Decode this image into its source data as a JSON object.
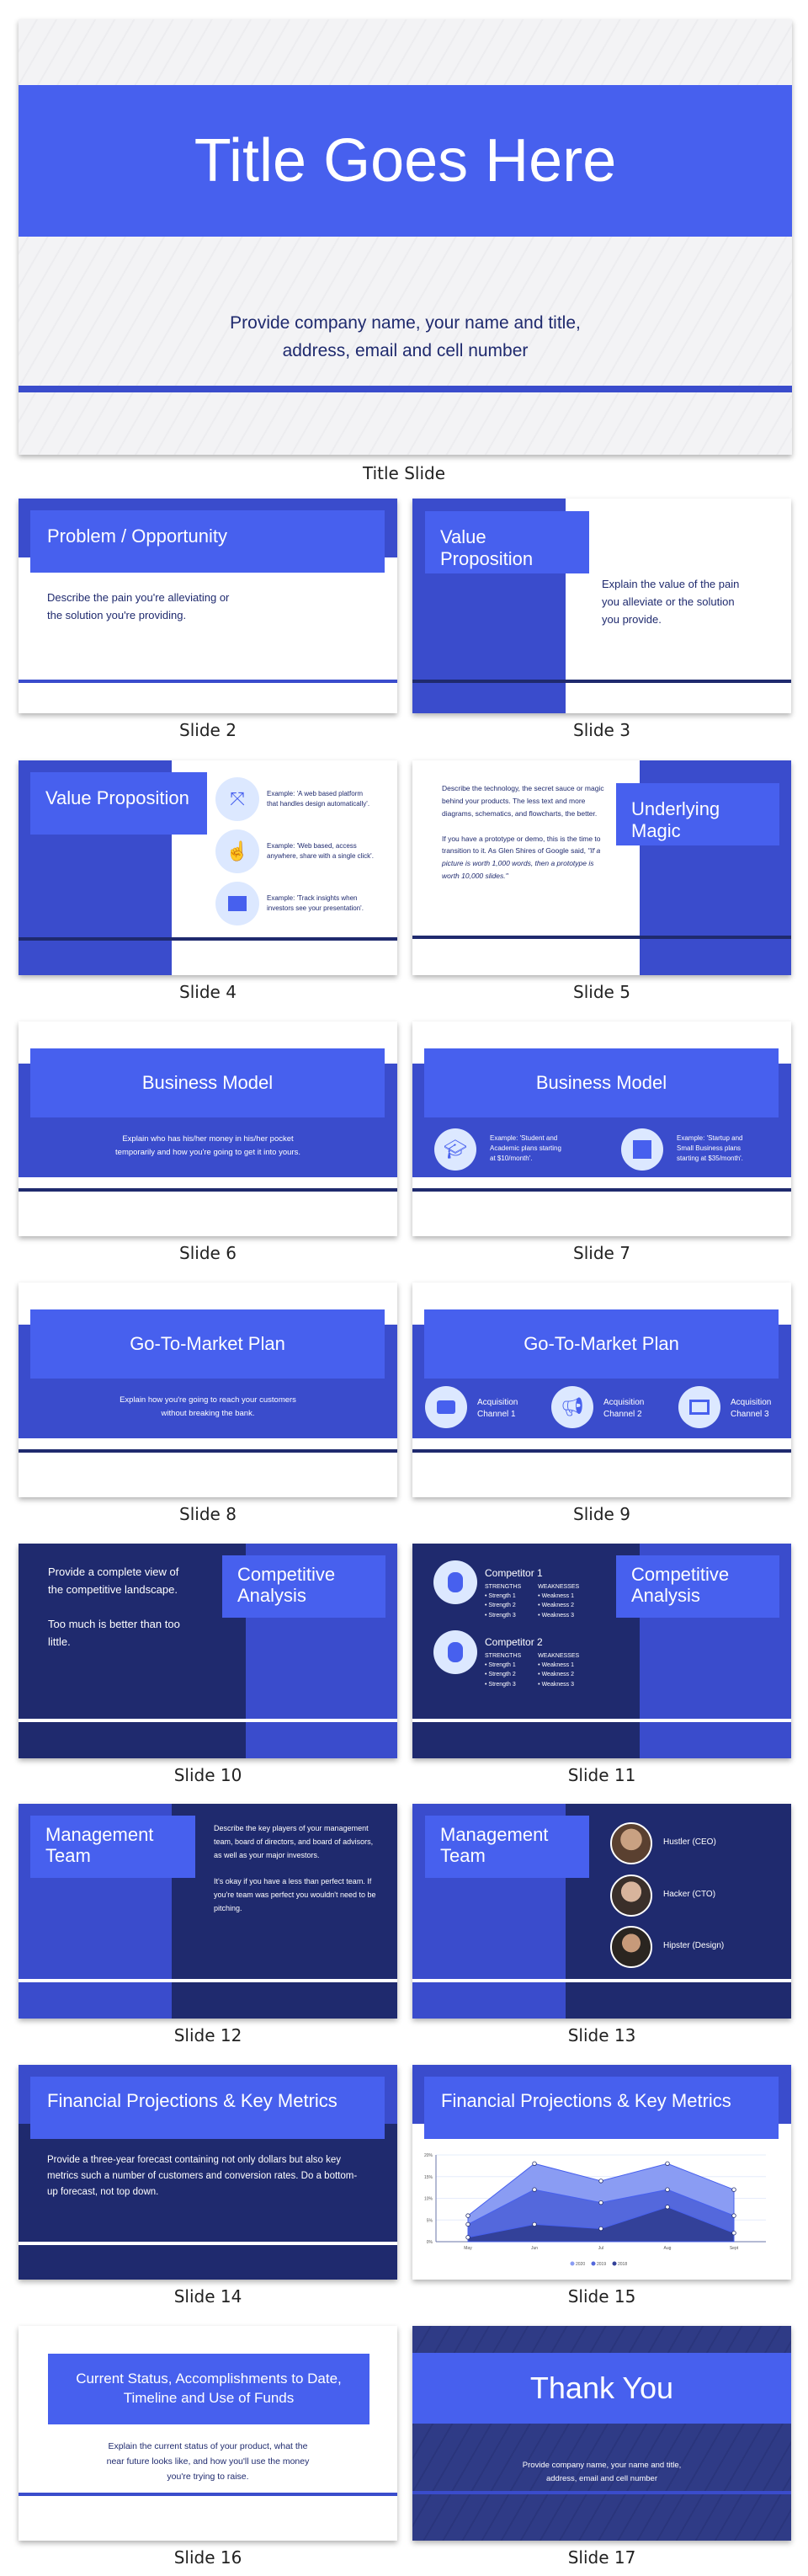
{
  "colors": {
    "blue": "#3a4ccc",
    "bright": "#4760ee",
    "navy": "#1f2a6e",
    "light": "#dce8ff"
  },
  "title_slide": {
    "title": "Title Goes Here",
    "subtitle1": "Provide company name, your name and title,",
    "subtitle2": "address, email and cell number",
    "label": "Title Slide"
  },
  "s2": {
    "title": "Problem / Opportunity",
    "body1": "Describe the pain you're alleviating or",
    "body2": "the solution you're providing.",
    "label": "Slide 2"
  },
  "s3": {
    "title": "Value Proposition",
    "body1": "Explain the value of the pain",
    "body2": "you alleviate or the solution",
    "body3": "you provide.",
    "label": "Slide 3"
  },
  "s4": {
    "title": "Value Proposition",
    "items": [
      {
        "icon": "expand-arrows-icon",
        "l1": "Example: 'A web based platform",
        "l2": "that handles design automatically'."
      },
      {
        "icon": "tap-hand-icon",
        "l1": "Example: 'Web based, access",
        "l2": "anywhere, share with a single click'."
      },
      {
        "icon": "presentation-chart-icon",
        "l1": "Example: 'Track insights when",
        "l2": "investors see your presentation'."
      }
    ],
    "label": "Slide 4"
  },
  "s5": {
    "title": "Underlying Magic",
    "p1": "Describe the technology, the secret sauce or magic behind your products. The less text and more diagrams, schematics, and flowcharts, the better.",
    "p2": "If you have a prototype or demo, this is the time to transition to it. As Glen Shires of Google said, ",
    "quote": "\"If a picture is worth 1,000 words, then a prototype is worth 10,000 slides.\"",
    "label": "Slide 5"
  },
  "s6": {
    "title": "Business Model",
    "body1": "Explain who has his/her money in his/her pocket",
    "body2": "temporarily and how you're going to get it into yours.",
    "label": "Slide 6"
  },
  "s7": {
    "title": "Business Model",
    "items": [
      {
        "icon": "graduation-cap-icon",
        "l1": "Example: 'Student and",
        "l2": "Academic plans starting",
        "l3": "at $10/month'."
      },
      {
        "icon": "storefront-icon",
        "l1": "Example: 'Startup and",
        "l2": "Small Business plans",
        "l3": "starting at $35/month'."
      }
    ],
    "label": "Slide 7"
  },
  "s8": {
    "title": "Go-To-Market Plan",
    "body1": "Explain how you're going to reach your customers",
    "body2": "without breaking the bank.",
    "label": "Slide 8"
  },
  "s9": {
    "title": "Go-To-Market Plan",
    "items": [
      {
        "icon": "chat-bubble-icon",
        "l1": "Acquisition",
        "l2": "Channel 1"
      },
      {
        "icon": "megaphone-icon",
        "l1": "Acquisition",
        "l2": "Channel 2"
      },
      {
        "icon": "monitor-icon",
        "l1": "Acquisition",
        "l2": "Channel 3"
      }
    ],
    "label": "Slide 9"
  },
  "s10": {
    "title1": "Competitive",
    "title2": "Analysis",
    "p1": "Provide a complete view of the competitive landscape.",
    "p2": "Too much is better than too little.",
    "label": "Slide 10"
  },
  "s11": {
    "title1": "Competitive",
    "title2": "Analysis",
    "competitors": [
      {
        "name": "Competitor 1",
        "sh": "STRENGTHS",
        "wh": "WEAKNESSES",
        "s": [
          "Strength 1",
          "Strength 2",
          "Strength 3"
        ],
        "w": [
          "Weakness 1",
          "Weakness 2",
          "Weakness 3"
        ]
      },
      {
        "name": "Competitor 2",
        "sh": "STRENGTHS",
        "wh": "WEAKNESSES",
        "s": [
          "Strength 1",
          "Strength 2",
          "Strength 3"
        ],
        "w": [
          "Weakness 1",
          "Weakness 2",
          "Weakness 3"
        ]
      }
    ],
    "label": "Slide 11"
  },
  "s12": {
    "title1": "Management",
    "title2": "Team",
    "p1": "Describe the key players of your management team, board of directors, and board of advisors, as well as your major investors.",
    "p2": "It's okay if you have a less than perfect team. If you're team was perfect you wouldn't need to be pitching.",
    "label": "Slide 12"
  },
  "s13": {
    "title1": "Management",
    "title2": "Team",
    "members": [
      "Hustler (CEO)",
      "Hacker (CTO)",
      "Hipster (Design)"
    ],
    "label": "Slide 13"
  },
  "s14": {
    "title": "Financial Projections & Key Metrics",
    "body": "Provide a three-year forecast containing not only dollars but also key metrics such a number of customers and conversion rates. Do a bottom-up forecast, not top down.",
    "label": "Slide 14"
  },
  "s15": {
    "title": "Financial Projections & Key Metrics",
    "label": "Slide 15"
  },
  "s16": {
    "title1": "Current Status, Accomplishments to Date,",
    "title2": "Timeline and Use of Funds",
    "body1": "Explain the current status of your product, what the",
    "body2": "near future looks like, and how you'll use the money",
    "body3": "you're trying to raise.",
    "label": "Slide 16"
  },
  "s17": {
    "title": "Thank You",
    "sub1": "Provide company name, your name and title,",
    "sub2": "address, email and cell number",
    "label": "Slide 17"
  },
  "chart_data": {
    "type": "area",
    "stacked_visual": true,
    "title": "",
    "x": [
      "May",
      "Jun",
      "Jul",
      "Aug",
      "Sept"
    ],
    "yticks": [
      "0%",
      "5%",
      "10%",
      "15%",
      "20%"
    ],
    "ylim": [
      0,
      20
    ],
    "legend": "bottom",
    "series": [
      {
        "name": "2020",
        "values": [
          6,
          18,
          14,
          18,
          12
        ],
        "color": "#8a9cf3"
      },
      {
        "name": "2019",
        "values": [
          4,
          12,
          9,
          12,
          6
        ],
        "color": "#5468dc"
      },
      {
        "name": "2018",
        "values": [
          1,
          4,
          3,
          8,
          2
        ],
        "color": "#334199"
      }
    ]
  }
}
